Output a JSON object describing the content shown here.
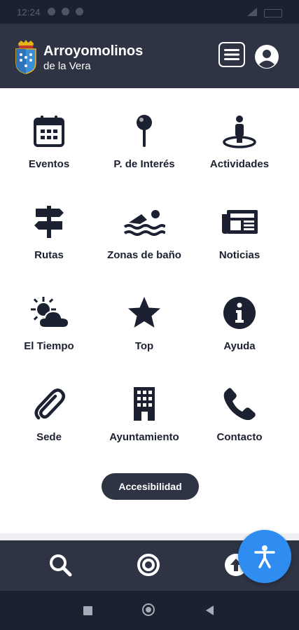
{
  "statusbar": {
    "time": "12:24"
  },
  "header": {
    "title": "Arroyomolinos",
    "subtitle": "de la Vera"
  },
  "tiles": [
    {
      "label": "Eventos",
      "icon": "calendar-icon"
    },
    {
      "label": "P. de Interés",
      "icon": "map-pin-icon"
    },
    {
      "label": "Actividades",
      "icon": "person-location-icon"
    },
    {
      "label": "Rutas",
      "icon": "signpost-icon"
    },
    {
      "label": "Zonas de baño",
      "icon": "swimmer-icon"
    },
    {
      "label": "Noticias",
      "icon": "newspaper-icon"
    },
    {
      "label": "El Tiempo",
      "icon": "sun-cloud-icon"
    },
    {
      "label": "Top",
      "icon": "star-icon"
    },
    {
      "label": "Ayuda",
      "icon": "info-icon"
    },
    {
      "label": "Sede",
      "icon": "paperclip-icon"
    },
    {
      "label": "Ayuntamiento",
      "icon": "building-icon"
    },
    {
      "label": "Contacto",
      "icon": "phone-icon"
    }
  ],
  "accessibility_button": {
    "label": "Accesibilidad"
  },
  "bottom_nav": [
    {
      "icon": "search-icon"
    },
    {
      "icon": "target-icon"
    },
    {
      "icon": "upload-icon"
    }
  ],
  "fab": {
    "icon": "accessibility-icon"
  },
  "colors": {
    "header_bg": "#2e3444",
    "text_dark": "#1b2131",
    "fab_blue": "#2f8cf0"
  }
}
